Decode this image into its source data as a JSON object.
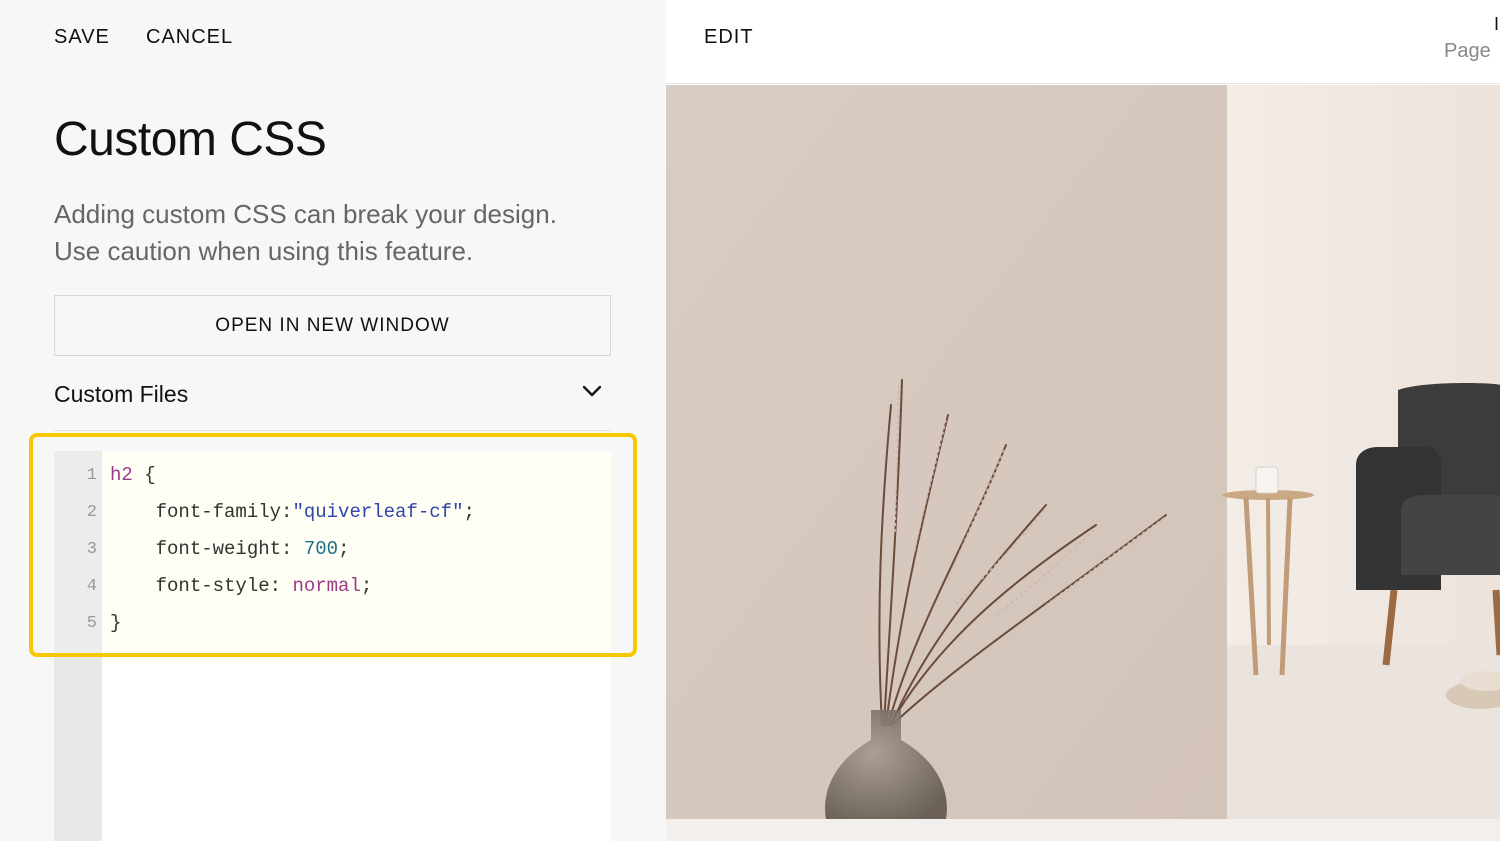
{
  "toolbar": {
    "save_label": "SAVE",
    "cancel_label": "CANCEL"
  },
  "panel": {
    "title": "Custom CSS",
    "warning_line1": "Adding custom CSS can break your design.",
    "warning_line2": "Use caution when using this feature.",
    "open_window_label": "OPEN IN NEW WINDOW",
    "custom_files_label": "Custom Files"
  },
  "editor": {
    "lines": [
      {
        "num": "1",
        "tokens": [
          {
            "t": "h2",
            "c": "sel"
          },
          {
            "t": " {",
            "c": ""
          }
        ]
      },
      {
        "num": "2",
        "tokens": [
          {
            "t": "    font-family:",
            "c": ""
          },
          {
            "t": "\"quiverleaf-cf\"",
            "c": "str"
          },
          {
            "t": ";",
            "c": ""
          }
        ]
      },
      {
        "num": "3",
        "tokens": [
          {
            "t": "    font-weight: ",
            "c": ""
          },
          {
            "t": "700",
            "c": "num"
          },
          {
            "t": ";",
            "c": ""
          }
        ]
      },
      {
        "num": "4",
        "tokens": [
          {
            "t": "    font-style: ",
            "c": ""
          },
          {
            "t": "normal",
            "c": "kw"
          },
          {
            "t": ";",
            "c": ""
          }
        ]
      },
      {
        "num": "5",
        "tokens": [
          {
            "t": "}",
            "c": ""
          }
        ]
      }
    ]
  },
  "preview": {
    "edit_label": "EDIT",
    "page_label": "Page",
    "page_label_top": "I"
  },
  "colors": {
    "highlight_border": "#f5c800",
    "wall_left": "#d8cbc1",
    "wall_right": "#f1e8e2",
    "sofa": "#3b3b3b"
  }
}
